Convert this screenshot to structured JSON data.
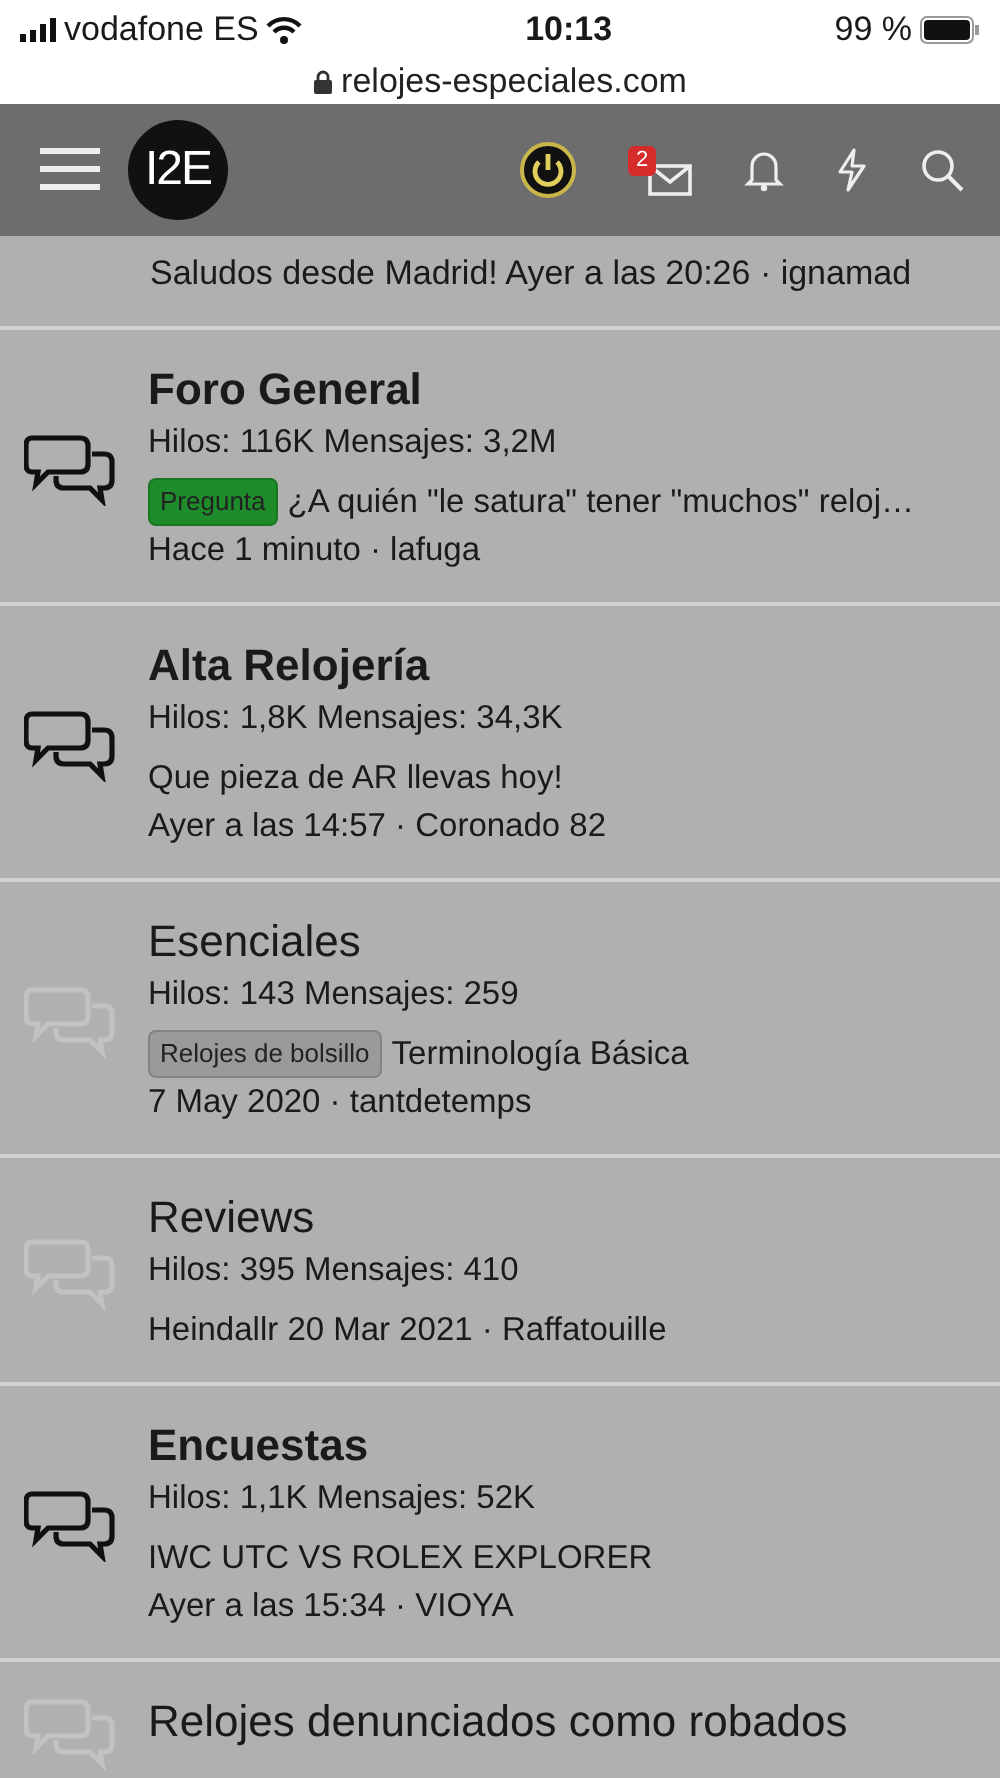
{
  "status_bar": {
    "carrier": "vodafone ES",
    "time": "10:13",
    "battery": "99 %"
  },
  "address_bar": {
    "url": "relojes-especiales.com"
  },
  "header": {
    "logo": "I2E",
    "inbox_badge": "2"
  },
  "partial_row": {
    "text": "Saludos desde Madrid! Ayer a las 20:26 · ignamad"
  },
  "forums": [
    {
      "title": "Foro General",
      "unread": true,
      "stats": "Hilos: 116K Mensajes: 3,2M",
      "tag": {
        "label": "Pregunta",
        "color": "#1e8c2b"
      },
      "last": "¿A quién \"le satura\" tener \"muchos\" reloj…",
      "meta": "Hace 1 minuto · lafuga"
    },
    {
      "title": "Alta Relojería",
      "unread": true,
      "stats": "Hilos: 1,8K Mensajes: 34,3K",
      "last": "Que pieza de AR llevas hoy!",
      "meta": "Ayer a las 14:57 · Coronado 82"
    },
    {
      "title": "Esenciales",
      "unread": false,
      "stats": "Hilos: 143 Mensajes: 259",
      "tag": {
        "label": "Relojes de bolsillo",
        "color": "#9a9a9a"
      },
      "last": "Terminología Básica",
      "meta": "7 May 2020 · tantdetemps"
    },
    {
      "title": "Reviews",
      "unread": false,
      "stats": "Hilos: 395 Mensajes: 410",
      "last": "Heindallr 20 Mar 2021 · Raffatouille"
    },
    {
      "title": "Encuestas",
      "unread": true,
      "stats": "Hilos: 1,1K Mensajes: 52K",
      "last": "IWC UTC VS ROLEX EXPLORER",
      "meta": "Ayer a las 15:34 · VIOYA"
    },
    {
      "title": "Relojes denunciados como robados",
      "unread": false
    }
  ]
}
